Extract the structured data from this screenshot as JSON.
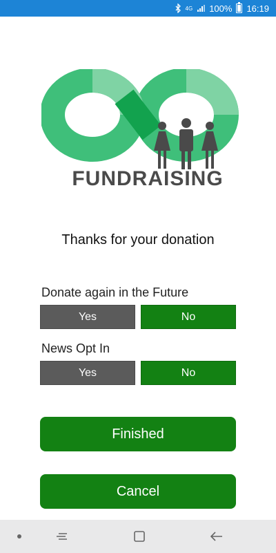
{
  "status_bar": {
    "network": "4G",
    "battery": "100%",
    "time": "16:19",
    "icons": [
      "bluetooth-icon",
      "signal-icon",
      "battery-icon"
    ]
  },
  "logo": {
    "text": "FUNDRAISING",
    "colors": {
      "green_light": "#7fd3a4",
      "green_mid": "#3fbf7a",
      "green_dark": "#12a24e",
      "people": "#4a4a4a"
    }
  },
  "header": {
    "title": "Thanks for your donation"
  },
  "questions": [
    {
      "label": "Donate again in the Future",
      "yes": "Yes",
      "no": "No"
    },
    {
      "label": "News Opt In",
      "yes": "Yes",
      "no": "No"
    }
  ],
  "actions": {
    "finished": "Finished",
    "cancel": "Cancel"
  },
  "colors": {
    "status_bar": "#1d84d6",
    "green": "#138113",
    "grey": "#5b5b5b",
    "nav_bar": "#e9e9ea"
  },
  "nav_bar": {
    "icons": [
      "dot-icon",
      "recent-apps-icon",
      "home-icon",
      "back-icon"
    ]
  }
}
